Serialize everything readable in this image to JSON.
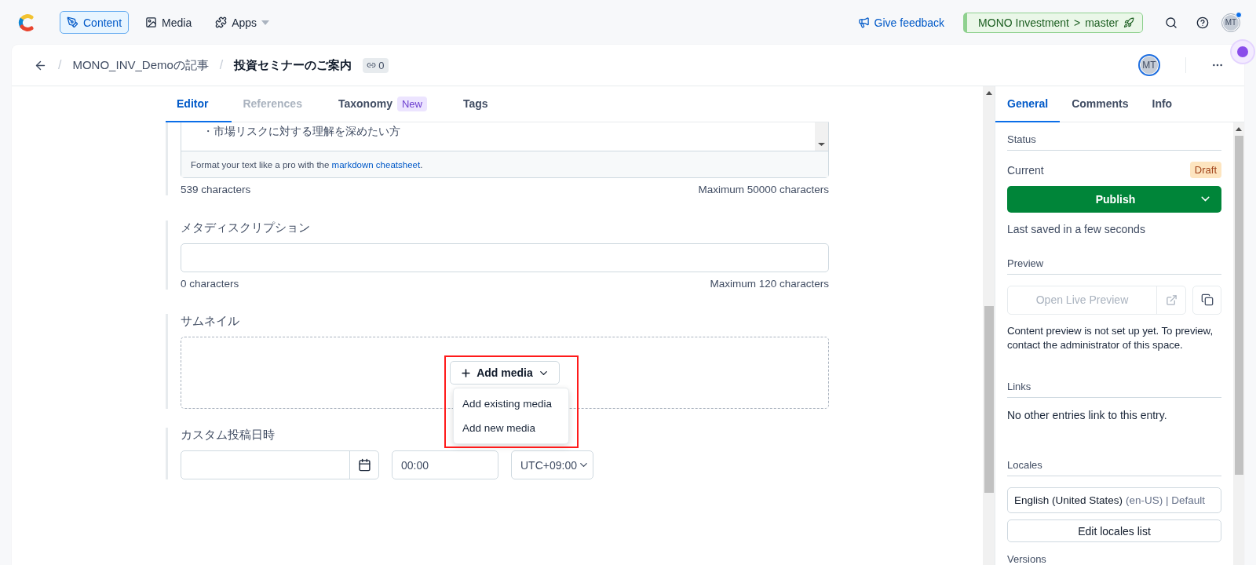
{
  "topnav": {
    "nav": [
      {
        "label": "Content",
        "selected": true,
        "kind": "pen"
      },
      {
        "label": "Media",
        "selected": false,
        "kind": "image"
      },
      {
        "label": "Apps",
        "selected": false,
        "kind": "apps"
      }
    ],
    "feedback": "Give feedback",
    "space": {
      "name": "MONO Investment",
      "separator": ">",
      "environment": "master"
    },
    "avatar": "MT",
    "notification": true
  },
  "header": {
    "separator": "/",
    "breadcrumb": "MONO_INV_Demoの記事",
    "title": "投資セミナーのご案内",
    "link_count": "0",
    "avatar": "MT"
  },
  "tabs": [
    {
      "label": "Editor",
      "selected": true,
      "disabled": false
    },
    {
      "label": "References",
      "selected": false,
      "disabled": true
    },
    {
      "label": "Taxonomy",
      "selected": false,
      "disabled": false,
      "badge": "New"
    },
    {
      "label": "Tags",
      "selected": false,
      "disabled": false
    }
  ],
  "markdown": {
    "content": "・市場リスクに対する理解を深めたい方",
    "hint_prefix": "Format your text like a pro with the ",
    "hint_link": "markdown cheatsheet",
    "hint_suffix": ".",
    "count": "539 characters",
    "max": "Maximum 50000 characters"
  },
  "meta": {
    "label": "メタディスクリプション",
    "count": "0 characters",
    "max": "Maximum 120 characters"
  },
  "thumbnail": {
    "label": "サムネイル",
    "button": "Add media",
    "menu": [
      "Add existing media",
      "Add new media"
    ],
    "highlighted": true
  },
  "date": {
    "label": "カスタム投稿日時",
    "time": "00:00",
    "timezone": "UTC+09:00"
  },
  "sidebar": {
    "tabs": [
      {
        "label": "General",
        "selected": true
      },
      {
        "label": "Comments",
        "selected": false
      },
      {
        "label": "Info",
        "selected": false
      }
    ],
    "status": {
      "heading": "Status",
      "current": "Current",
      "badge": "Draft",
      "publish": "Publish",
      "saved": "Last saved in a few seconds"
    },
    "preview": {
      "heading": "Preview",
      "button": "Open Live Preview",
      "note": "Content preview is not set up yet. To preview, contact the administrator of this space."
    },
    "links": {
      "heading": "Links",
      "note": "No other entries link to this entry."
    },
    "locales": {
      "heading": "Locales",
      "name": "English (United States)",
      "code": "(en-US) | Default",
      "button": "Edit locales list"
    },
    "versions": {
      "heading": "Versions"
    }
  }
}
